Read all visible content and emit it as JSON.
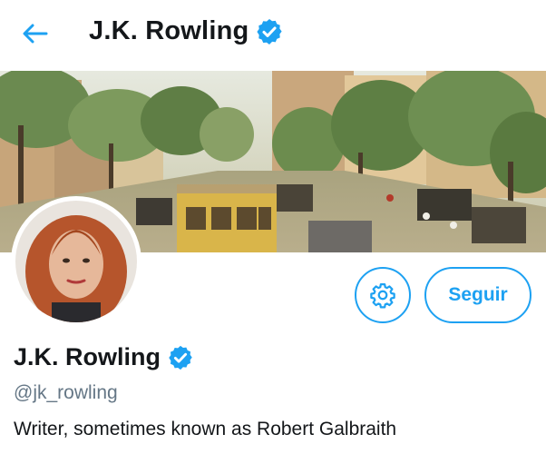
{
  "header": {
    "back_icon": "arrow-left-icon",
    "title": "J.K. Rowling",
    "verified_icon": "verified-badge-icon"
  },
  "banner": {
    "description_icon": "banner-image"
  },
  "profile": {
    "display_name": "J.K. Rowling",
    "handle": "@jk_rowling",
    "bio": "Writer, sometimes known as Robert Galbraith",
    "verified_icon": "verified-badge-icon"
  },
  "actions": {
    "settings_icon": "gear-icon",
    "follow_label": "Seguir"
  },
  "colors": {
    "accent": "#1da1f2",
    "text_primary": "#14171a",
    "text_secondary": "#657786"
  }
}
